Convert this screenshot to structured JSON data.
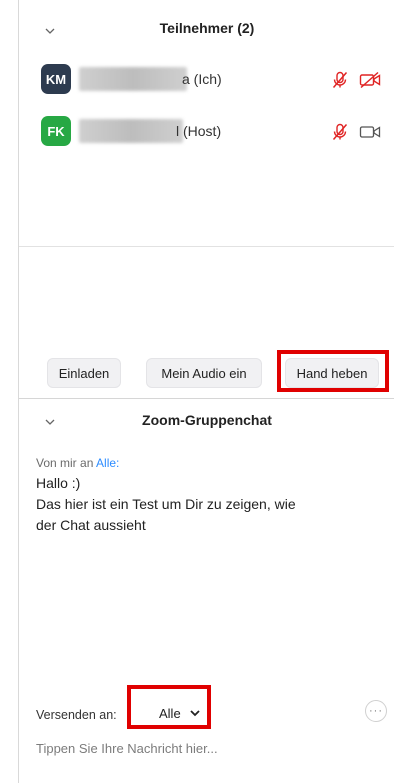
{
  "participants": {
    "title": "Teilnehmer (2)",
    "list": [
      {
        "initials": "KM",
        "avatar_color": "#2d3b4f",
        "name_suffix": "a (Ich)",
        "audio_icon": "mic-muted-icon",
        "video_icon": "video-off-icon"
      },
      {
        "initials": "FK",
        "avatar_color": "#27a844",
        "name_suffix": "l (Host)",
        "audio_icon": "mic-muted-icon",
        "video_icon": "video-icon"
      }
    ],
    "buttons": {
      "invite": "Einladen",
      "audio": "Mein Audio ein",
      "raise_hand": "Hand heben"
    }
  },
  "chat": {
    "title": "Zoom-Gruppenchat",
    "message": {
      "meta_prefix": "Von mir an",
      "meta_to": "Alle:",
      "lines": [
        "Hallo :)",
        "Das hier ist ein Test um Dir zu zeigen, wie",
        "der Chat aussieht"
      ]
    },
    "send_to_label": "Versenden an:",
    "send_to_value": "Alle",
    "input_placeholder": "Tippen Sie Ihre Nachricht hier...",
    "more_label": "···"
  },
  "colors": {
    "highlight": "#e00000",
    "muted_red": "#e02424",
    "link_blue": "#2d8cff"
  }
}
